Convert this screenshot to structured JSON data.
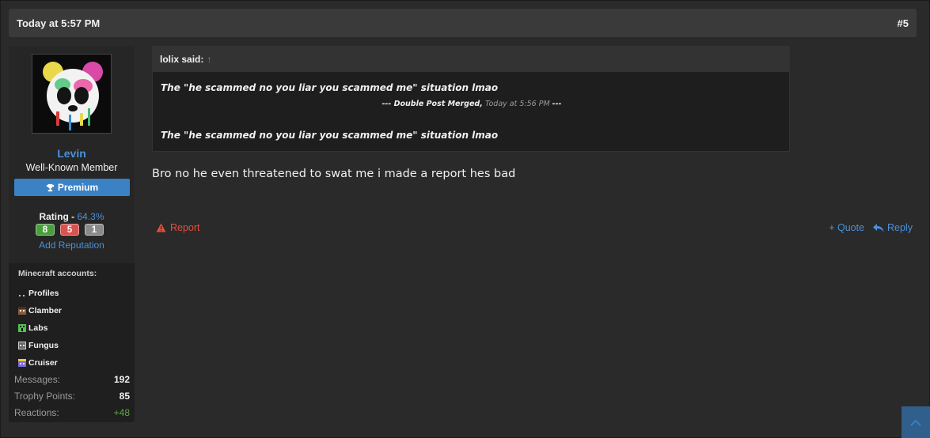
{
  "post": {
    "timestamp": "Today at 5:57 PM",
    "number": "#5"
  },
  "user": {
    "name": "Levin",
    "title": "Well-Known Member",
    "banner": "Premium",
    "rating_label": "Rating -",
    "rating_pct": "64.3%",
    "rating_positive": "8",
    "rating_negative": "5",
    "rating_neutral": "1",
    "add_reputation": "Add Reputation",
    "minecraft_heading": "Minecraft accounts:",
    "minecraft_accounts": [
      {
        "name": "Profiles",
        "icon": "skin-dark-icon"
      },
      {
        "name": "Clamber",
        "icon": "skin-brown-icon"
      },
      {
        "name": "Labs",
        "icon": "skin-creeper-icon"
      },
      {
        "name": "Fungus",
        "icon": "skin-gray-icon"
      },
      {
        "name": "Cruiser",
        "icon": "skin-purple-icon"
      }
    ],
    "stats": [
      {
        "label": "Messages:",
        "value": "192"
      },
      {
        "label": "Trophy Points:",
        "value": "85"
      },
      {
        "label": "Reactions:",
        "value": "+48"
      }
    ]
  },
  "quote": {
    "author": "lolix said:",
    "line1": "The \"he scammed no you liar you scammed me\" situation lmao",
    "merged_label": "--- Double Post Merged,",
    "merged_time": "Today at 5:56 PM",
    "merged_end": "---",
    "line2": "The \"he scammed no you liar you scammed me\" situation lmao"
  },
  "message": "Bro no he even threatened to swat me i made a report hes bad",
  "actions": {
    "report": "Report",
    "quote": "+ Quote",
    "reply": "Reply"
  },
  "colors": {
    "accent": "#4a90d9",
    "report": "#e74c3c",
    "positive": "#4b9e3d",
    "negative": "#d9534f",
    "neutral": "#8a8a8a"
  }
}
